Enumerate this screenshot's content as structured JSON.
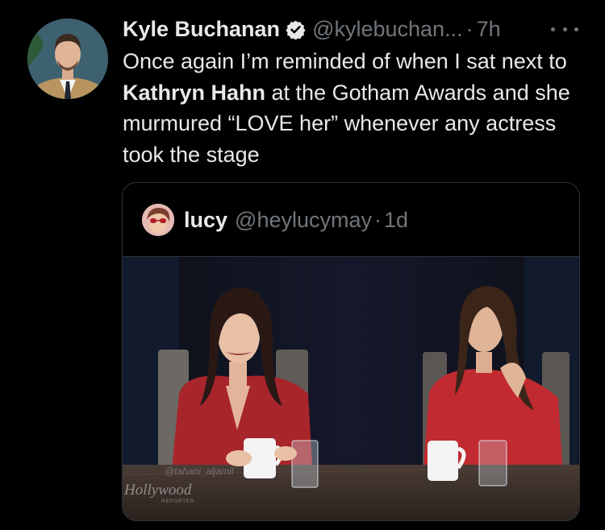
{
  "tweet": {
    "author_name": "Kyle Buchanan",
    "handle": "@kylebuchan...",
    "separator": "·",
    "time": "7h",
    "text": {
      "part1": "Once again I’m reminded of when I sat next to ",
      "bold": "Kathryn Hahn",
      "part2": " at the Gotham Awards and she murmured “LOVE her” whenever any actress took the stage"
    }
  },
  "quoted_tweet": {
    "author_name": "lucy",
    "handle": "@heylucymay",
    "separator": "·",
    "time": "1d",
    "media": {
      "watermark_handle": "@tahani_aljamil",
      "watermark_logo": "Hollywood",
      "watermark_sub": "REPORTER"
    }
  },
  "icons": {
    "verified": "verified-badge-icon",
    "more": "more-options-icon"
  },
  "colors": {
    "background": "#000000",
    "text_primary": "#e7e9ea",
    "text_secondary": "#71767b",
    "border": "#2f3336"
  }
}
